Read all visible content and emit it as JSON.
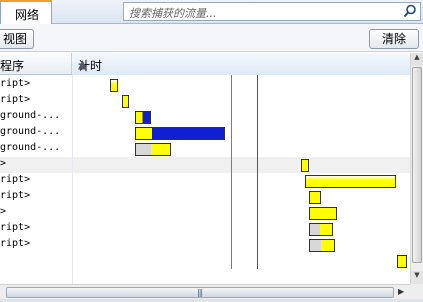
{
  "tabs": [
    {
      "label": "网络"
    }
  ],
  "search": {
    "placeholder": "搜索捕获的流量..."
  },
  "toolbar": {
    "view_label": "视图",
    "clear_label": "清除"
  },
  "columns": {
    "initiator": "程序",
    "timing": "计时"
  },
  "colors": {
    "yellow": "#ffff00",
    "blue": "#1020d0",
    "gray": "#d8d8d8",
    "dom_line": "#22bb22",
    "load_line": "#cc2222"
  },
  "rows": [
    {
      "name": "ript>"
    },
    {
      "name": "ript>"
    },
    {
      "name": "ground-..."
    },
    {
      "name": "ground-..."
    },
    {
      "name": "ground-..."
    },
    {
      "name": ">"
    },
    {
      "name": "ript>"
    },
    {
      "name": "ript>"
    },
    {
      "name": ">"
    },
    {
      "name": "ript>"
    },
    {
      "name": "ript>"
    },
    {
      "name": ""
    }
  ]
}
